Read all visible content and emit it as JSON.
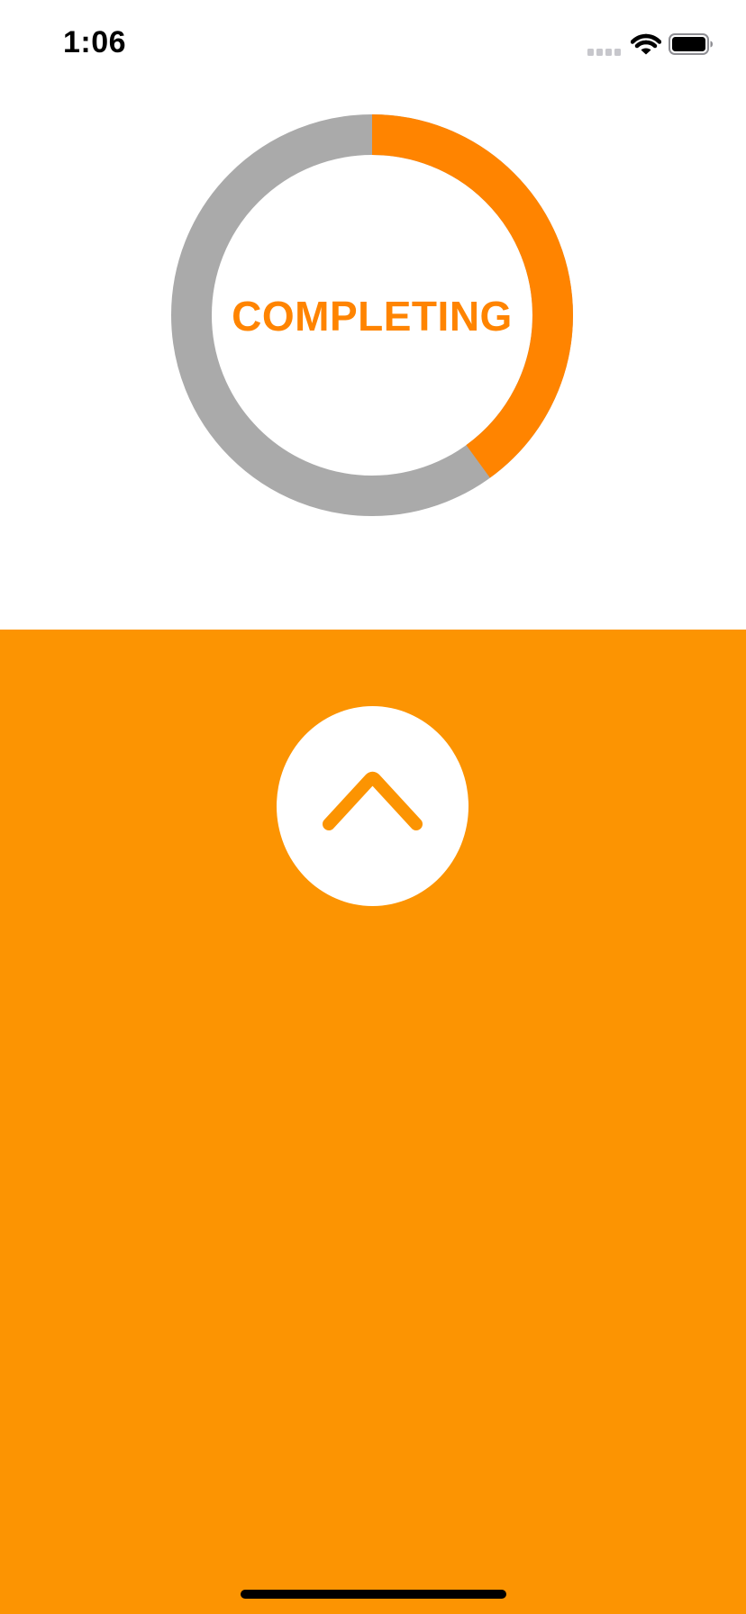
{
  "status_bar": {
    "time": "1:06",
    "icons": [
      "cellular-signal-icon",
      "wifi-icon",
      "battery-icon"
    ]
  },
  "progress": {
    "label": "COMPLETING",
    "fraction": 0.4,
    "progress_color": "#FF8400",
    "track_color": "#AAAAAA",
    "label_color": "#FF8400"
  },
  "bottom_panel": {
    "background_color": "#FC9402",
    "button_icon": "chevron-up-icon",
    "button_color": "#FFFFFF",
    "icon_color": "#FC9402"
  }
}
